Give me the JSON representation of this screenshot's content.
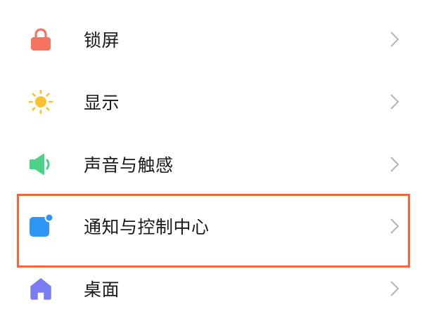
{
  "settings": {
    "items": [
      {
        "id": "lock",
        "label": "锁屏",
        "icon": "lock-icon",
        "icon_color": "#f4735f"
      },
      {
        "id": "display",
        "label": "显示",
        "icon": "sun-icon",
        "icon_color": "#fbc02d"
      },
      {
        "id": "sound",
        "label": "声音与触感",
        "icon": "speaker-icon",
        "icon_color": "#4cd18a"
      },
      {
        "id": "notify",
        "label": "通知与控制中心",
        "icon": "notification-icon",
        "icon_color": "#2f97f3"
      },
      {
        "id": "desktop",
        "label": "桌面",
        "icon": "home-icon",
        "icon_color": "#7a7cf2"
      }
    ]
  },
  "highlight": {
    "target": "通知与控制中心",
    "color": "#ee6a3c"
  },
  "colors": {
    "chevron": "#b5b5b5",
    "text": "#1a1a1a",
    "background": "#ffffff"
  }
}
